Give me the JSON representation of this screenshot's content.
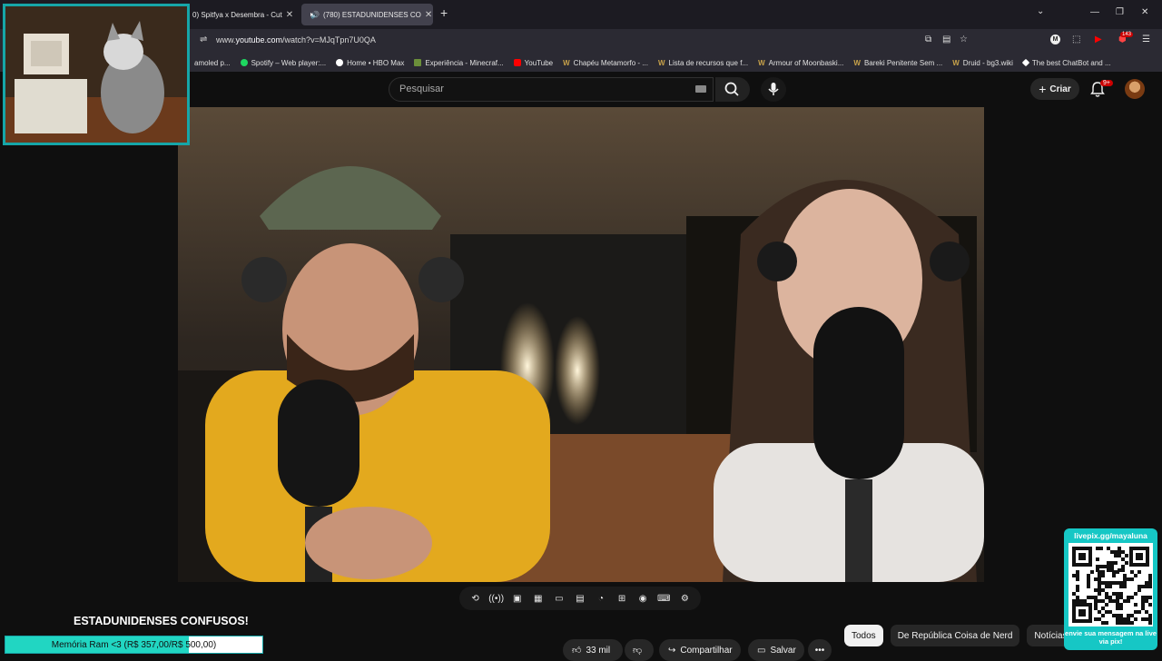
{
  "browser": {
    "tabs": [
      {
        "label": "0) Spitfya x Desembra - Cut"
      },
      {
        "label": "(780) ESTADUNIDENSES CO"
      }
    ],
    "url_prefix": "www.",
    "url_host": "youtube.com",
    "url_path": "/watch?v=MJqTpn7U0QA",
    "extension_badge": "143",
    "bookmarks": [
      {
        "label": "amoled p...",
        "color": "#6a6a6a"
      },
      {
        "label": "Spotify – Web player:...",
        "color": "#1ed760"
      },
      {
        "label": "Home • HBO Max",
        "color": "#ffffff"
      },
      {
        "label": "Experiência - Minecraf...",
        "color": "#6b8f3a"
      },
      {
        "label": "YouTube",
        "color": "#ff0000"
      },
      {
        "label": "Chapéu Metamorfo - ...",
        "color": "#c8a24a"
      },
      {
        "label": "Lista de recursos que f...",
        "color": "#c8a24a"
      },
      {
        "label": "Armour of Moonbaski...",
        "color": "#c8a24a"
      },
      {
        "label": "Bareki Penitente Sem ...",
        "color": "#c8a24a"
      },
      {
        "label": "Druid - bg3.wiki",
        "color": "#c8a24a"
      },
      {
        "label": "The best ChatBot and ...",
        "color": "#ffffff"
      }
    ]
  },
  "youtube": {
    "search_placeholder": "Pesquisar",
    "create_label": "Criar",
    "notification_badge": "9+",
    "video_title": "ESTADUNIDENSES CONFUSOS!",
    "like_count": "33 mil",
    "share_label": "Compartilhar",
    "save_label": "Salvar",
    "more_label": "•••",
    "chips": [
      "Todos",
      "De República Coisa de Nerd",
      "Notícias"
    ]
  },
  "overlay": {
    "goal_text": "Memória Ram <3 (R$ 357,00/R$ 500,00)",
    "goal_progress": 0.714,
    "qr_top": "livepix.gg/mayaluna",
    "qr_bottom": "envie sua mensagem na live via pix!"
  },
  "colors": {
    "accent_teal": "#16a6a8",
    "youtube_red": "#ff0000",
    "goal_fill": "#21d6c2"
  }
}
